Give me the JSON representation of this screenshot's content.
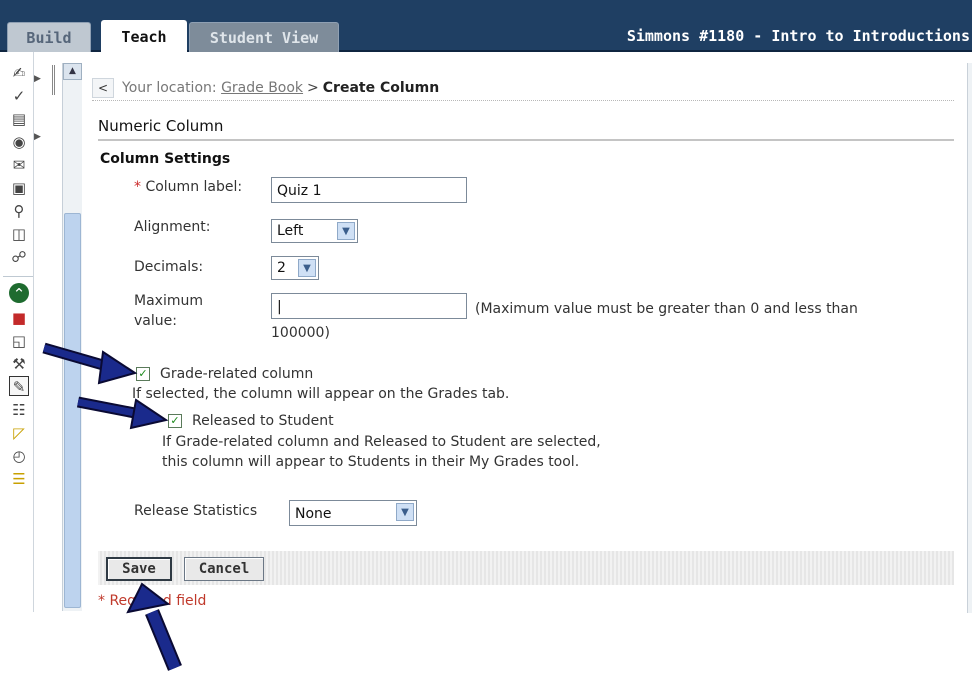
{
  "tabs": {
    "build": "Build",
    "teach": "Teach",
    "student_view": "Student View"
  },
  "course_title": "Simmons #1180 - Intro to Introductions",
  "breadcrumb": {
    "back": "<",
    "prefix": "Your location:",
    "link": "Grade Book",
    "separator": ">",
    "current": "Create Column"
  },
  "form": {
    "section_title": "Numeric Column",
    "subsection_title": "Column Settings",
    "column_label": {
      "star": "*",
      "label": "Column label:",
      "value": "Quiz 1"
    },
    "alignment": {
      "label": "Alignment:",
      "value": "Left"
    },
    "decimals": {
      "label": "Decimals:",
      "value": "2"
    },
    "maximum_value": {
      "label_line1": "Maximum",
      "label_line2": "value:",
      "value": "|",
      "hint_line1": "(Maximum value must be greater than 0 and less than",
      "hint_line2": "100000)"
    },
    "grade_related": {
      "label": "Grade-related column",
      "help": "If selected, the column will appear on the Grades tab."
    },
    "released": {
      "label": "Released to Student",
      "help_line1": "If Grade-related column and Released to Student are selected,",
      "help_line2": "this column will appear to Students in their My Grades tool."
    },
    "release_statistics": {
      "label": "Release Statistics",
      "value": "None"
    }
  },
  "buttons": {
    "save": "Save",
    "cancel": "Cancel"
  },
  "required_note": "* Required field",
  "colors": {
    "topbar": "#1f3f63",
    "required": "#cc2b2b",
    "arrow": "#1a2a8c",
    "checkmark": "#1a8a1a"
  },
  "icons": {
    "checkbox": "✓",
    "select_arrow": "▼",
    "scroll_up": "▲"
  }
}
